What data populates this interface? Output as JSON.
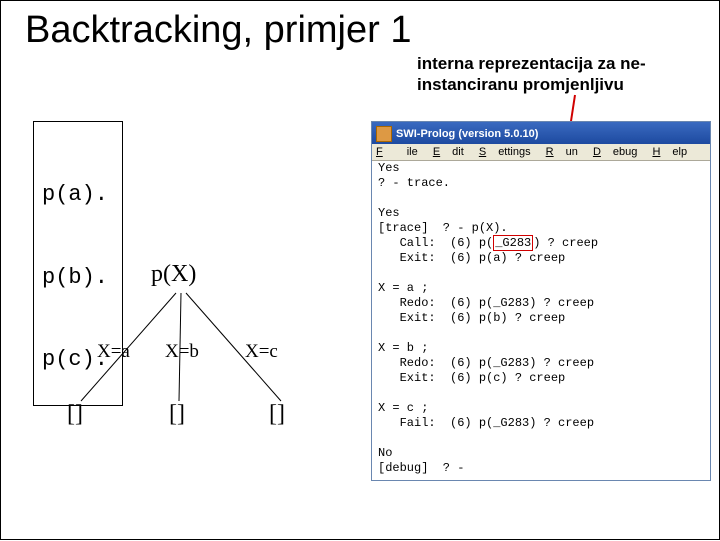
{
  "title": "Backtracking, primjer 1",
  "subtitle_line1": "interna reprezentacija za ne-",
  "subtitle_line2": "instanciranu promjenljivu",
  "code": {
    "l1": "p(a).",
    "l2": "p(b).",
    "l3": "p(c)."
  },
  "tree": {
    "root": "p(X)",
    "edge_a": "X=a",
    "edge_b": "X=b",
    "edge_c": "X=c",
    "leaf": "[]"
  },
  "swi": {
    "title": "SWI-Prolog (version 5.0.10)",
    "menu": {
      "file": "File",
      "edit": "Edit",
      "settings": "Settings",
      "run": "Run",
      "debug": "Debug",
      "help": "Help"
    },
    "body": "Yes\n? - trace.\n\nYes\n[trace]  ? - p(X).\n   Call:  (6) p(_G283) ? creep\n   Exit:  (6) p(a) ? creep\n\nX = a ;\n   Redo:  (6) p(_G283) ? creep\n   Exit:  (6) p(b) ? creep\n\nX = b ;\n   Redo:  (6) p(_G283) ? creep\n   Exit:  (6) p(c) ? creep\n\nX = c ;\n   Fail:  (6) p(_G283) ? creep\n\nNo\n[debug]  ? -",
    "highlight_text": "_G283"
  }
}
